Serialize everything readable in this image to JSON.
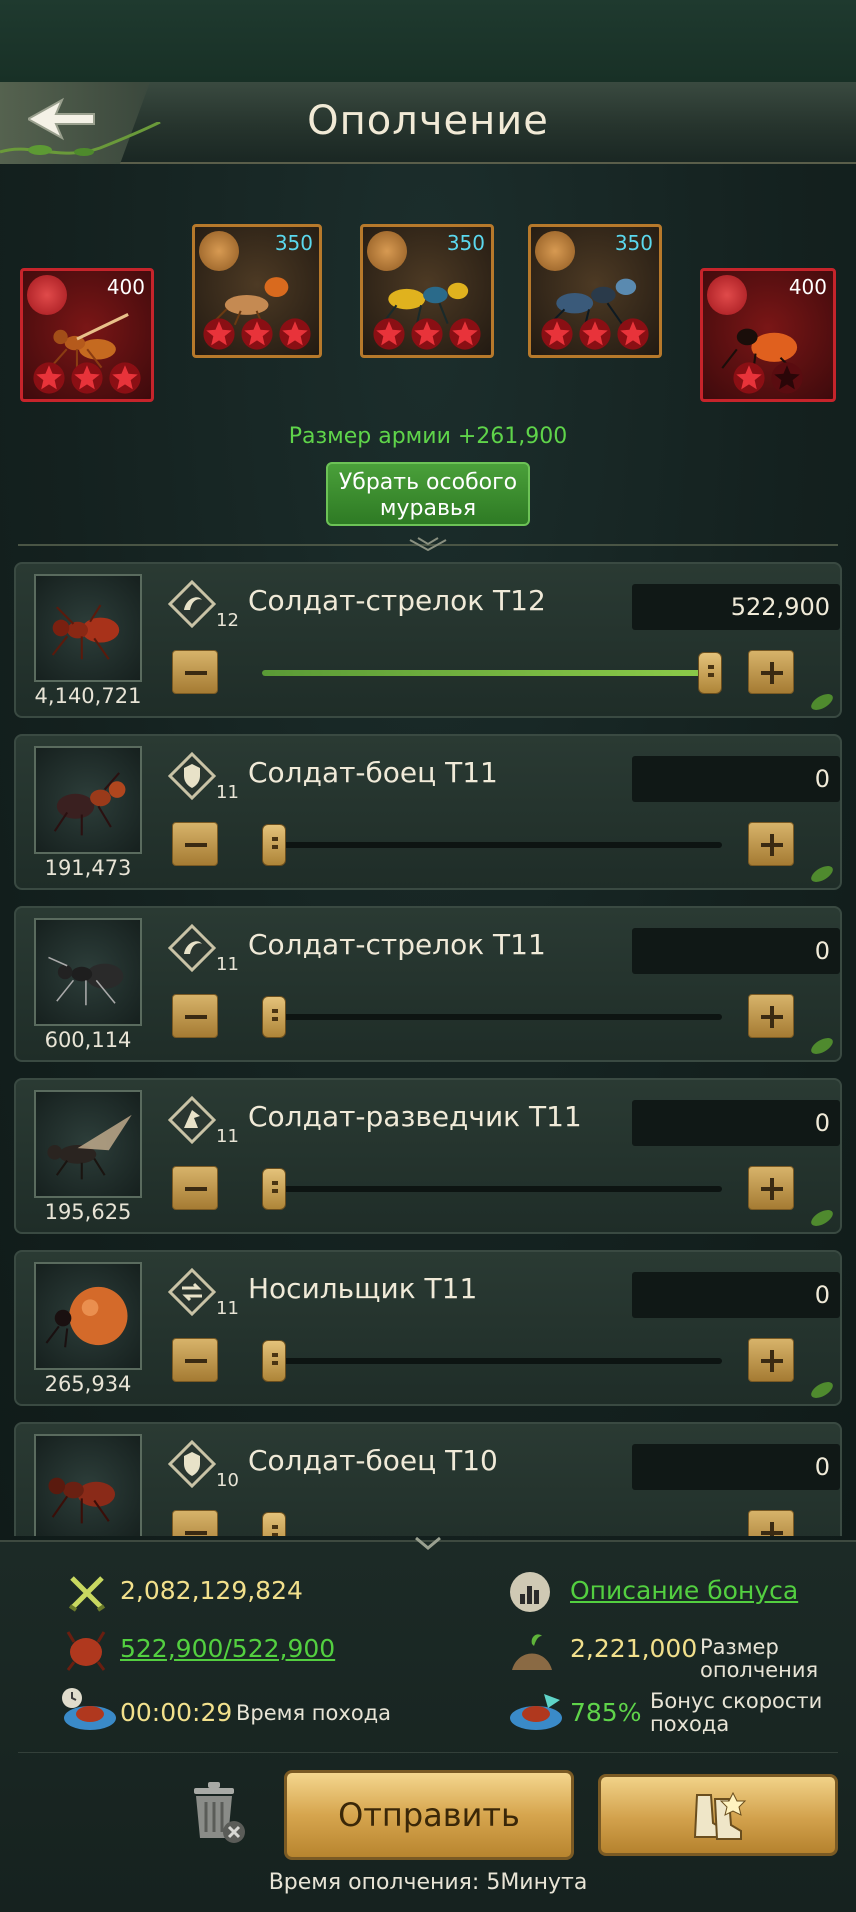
{
  "header": {
    "title": "Ополчение"
  },
  "heroes": [
    {
      "level": "400",
      "frame": "red",
      "stars_filled": 3,
      "stars_total": 3
    },
    {
      "level": "350",
      "frame": "gold",
      "stars_filled": 3,
      "stars_total": 3
    },
    {
      "level": "350",
      "frame": "gold",
      "stars_filled": 3,
      "stars_total": 3
    },
    {
      "level": "350",
      "frame": "gold",
      "stars_filled": 3,
      "stars_total": 3
    },
    {
      "level": "400",
      "frame": "red",
      "stars_filled": 1,
      "stars_total": 2
    }
  ],
  "army_size": "Размер армии +261,900",
  "remove_button": {
    "line1": "Убрать особого",
    "line2": "муравья"
  },
  "troops": [
    {
      "name": "Солдат-стрелок T12",
      "tier": "12",
      "count": "4,140,721",
      "qty": "522,900",
      "fill": 1.0,
      "type_icon": "archer-icon"
    },
    {
      "name": "Солдат-боец T11",
      "tier": "11",
      "count": "191,473",
      "qty": "0",
      "fill": 0.0,
      "type_icon": "shield-icon"
    },
    {
      "name": "Солдат-стрелок T11",
      "tier": "11",
      "count": "600,114",
      "qty": "0",
      "fill": 0.0,
      "type_icon": "archer-icon"
    },
    {
      "name": "Солдат-разведчик T11",
      "tier": "11",
      "count": "195,625",
      "qty": "0",
      "fill": 0.0,
      "type_icon": "scout-icon"
    },
    {
      "name": "Носильщик T11",
      "tier": "11",
      "count": "265,934",
      "qty": "0",
      "fill": 0.0,
      "type_icon": "carrier-icon"
    },
    {
      "name": "Солдат-боец T10",
      "tier": "10",
      "count": "",
      "qty": "0",
      "fill": 0.0,
      "type_icon": "shield-icon"
    }
  ],
  "stats": {
    "power": "2,082,129,824",
    "bonus_link": "Описание бонуса",
    "troops_sent": "522,900/522,900",
    "rally_size_value": "2,221,000",
    "rally_size_label_1": "Размер",
    "rally_size_label_2": "ополчения",
    "march_time": "00:00:29",
    "march_time_label": "Время похода",
    "speed_bonus": "785%",
    "speed_label_1": "Бонус скорости",
    "speed_label_2": "похода"
  },
  "send_button": "Отправить",
  "rally_time_note": "Время ополчения: 5Минута",
  "colors": {
    "accent_green": "#5fd44a",
    "gold": "#d6a54e",
    "red_frame": "#c6242b"
  }
}
